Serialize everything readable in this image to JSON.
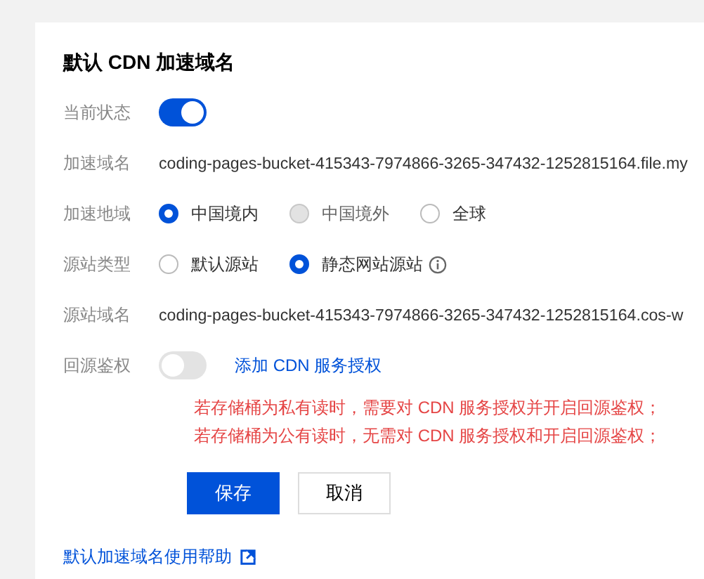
{
  "title": "默认 CDN 加速域名",
  "fields": [
    {
      "kind": "toggle",
      "label": "当前状态",
      "on": true
    },
    {
      "kind": "text",
      "label": "加速域名",
      "value": "coding-pages-bucket-415343-7974866-3265-347432-1252815164.file.my"
    },
    {
      "kind": "radio",
      "label": "加速地域",
      "options": [
        {
          "label": "中国境内",
          "selected": true,
          "disabled": false
        },
        {
          "label": "中国境外",
          "selected": false,
          "disabled": true
        },
        {
          "label": "全球",
          "selected": false,
          "disabled": false
        }
      ]
    },
    {
      "kind": "radio",
      "label": "源站类型",
      "options": [
        {
          "label": "默认源站",
          "selected": false,
          "disabled": false
        },
        {
          "label": "静态网站源站",
          "selected": true,
          "disabled": false,
          "info": true
        }
      ]
    },
    {
      "kind": "text",
      "label": "源站域名",
      "value": "coding-pages-bucket-415343-7974866-3265-347432-1252815164.cos-w"
    },
    {
      "kind": "toggle",
      "label": "回源鉴权",
      "on": false,
      "link": "添加 CDN 服务授权"
    }
  ],
  "notes": [
    "若存储桶为私有读时，需要对 CDN 服务授权并开启回源鉴权；",
    "若存储桶为公有读时，无需对 CDN 服务授权和开启回源鉴权；"
  ],
  "buttons": [
    {
      "label": "保存",
      "primary": true
    },
    {
      "label": "取消",
      "primary": false
    }
  ],
  "help_link": "默认加速域名使用帮助"
}
